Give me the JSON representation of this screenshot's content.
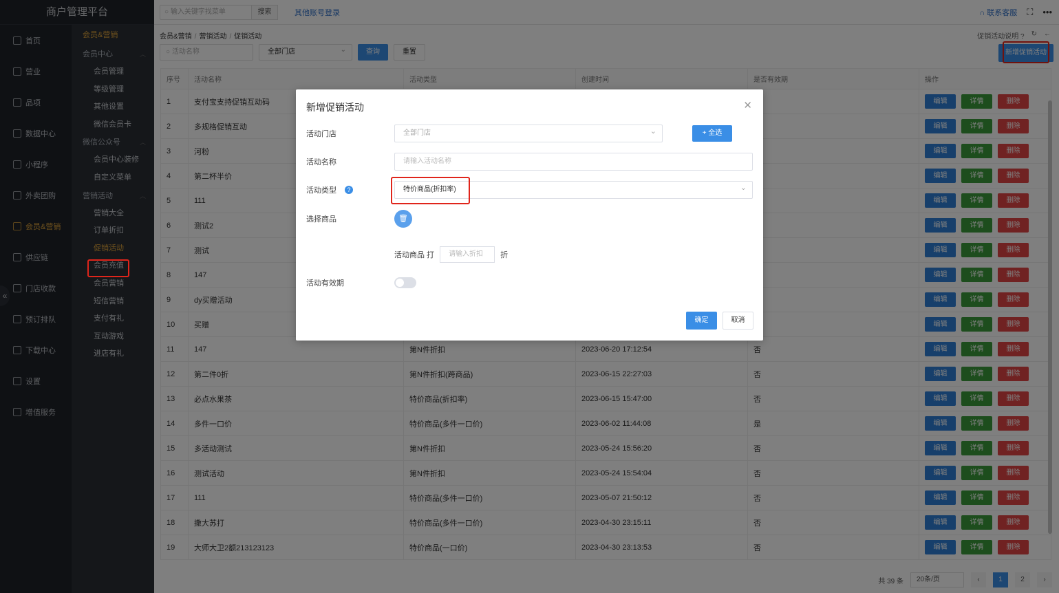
{
  "app": {
    "title": "商户管理平台"
  },
  "topbar": {
    "search_placeholder": "输入关键字找菜单",
    "search_btn": "搜索",
    "other_login": "其他账号登录",
    "contact": "联系客服"
  },
  "main_nav": [
    {
      "label": "首页",
      "icon": "home-icon"
    },
    {
      "label": "营业",
      "icon": "calendar-icon"
    },
    {
      "label": "品项",
      "icon": "bag-icon"
    },
    {
      "label": "数据中心",
      "icon": "share-icon"
    },
    {
      "label": "小程序",
      "icon": "phone-icon"
    },
    {
      "label": "外卖团购",
      "icon": "group-icon"
    },
    {
      "label": "会员&营销",
      "icon": "user-icon"
    },
    {
      "label": "供应链",
      "icon": "truck-icon"
    },
    {
      "label": "门店收款",
      "icon": "database-icon"
    },
    {
      "label": "预订排队",
      "icon": "clock-icon"
    },
    {
      "label": "下载中心",
      "icon": "download-icon"
    },
    {
      "label": "设置",
      "icon": "gear-icon"
    },
    {
      "label": "增值服务",
      "icon": "alarm-icon"
    }
  ],
  "sub_nav": {
    "header": "会员&营销",
    "groups": [
      {
        "label": "会员中心",
        "items": [
          "会员管理",
          "等级管理",
          "其他设置",
          "微信会员卡"
        ]
      },
      {
        "label": "微信公众号",
        "items": [
          "会员中心装修",
          "自定义菜单"
        ]
      },
      {
        "label": "营销活动",
        "items": [
          "营销大全",
          "订单折扣",
          "促销活动",
          "会员充值",
          "会员营销",
          "短信营销",
          "支付有礼",
          "互动游戏",
          "进店有礼"
        ]
      }
    ]
  },
  "breadcrumb": [
    "会员&营销",
    "营销活动",
    "促销活动"
  ],
  "page_help": "促销活动说明",
  "filters": {
    "name_placeholder": "活动名称",
    "store_value": "全部门店",
    "query_btn": "查询",
    "reset_btn": "重置"
  },
  "add_btn": "新增促销活动",
  "table": {
    "headers": [
      "序号",
      "活动名称",
      "活动类型",
      "创建时间",
      "是否有效期",
      "操作"
    ],
    "op_labels": {
      "edit": "编辑",
      "detail": "详情",
      "delete": "删除"
    },
    "rows": [
      {
        "no": "1",
        "name": "支付宝支持促销互动码",
        "type": "",
        "created": "",
        "valid": ""
      },
      {
        "no": "2",
        "name": "多规格促销互动",
        "type": "",
        "created": "",
        "valid": ""
      },
      {
        "no": "3",
        "name": "河粉",
        "type": "",
        "created": "",
        "valid": ""
      },
      {
        "no": "4",
        "name": "第二杯半价",
        "type": "",
        "created": "",
        "valid": ""
      },
      {
        "no": "5",
        "name": "111",
        "type": "",
        "created": "",
        "valid": ""
      },
      {
        "no": "6",
        "name": "测试2",
        "type": "",
        "created": "",
        "valid": ""
      },
      {
        "no": "7",
        "name": "测试",
        "type": "",
        "created": "",
        "valid": ""
      },
      {
        "no": "8",
        "name": "147",
        "type": "",
        "created": "",
        "valid": ""
      },
      {
        "no": "9",
        "name": "dy买赠活动",
        "type": "",
        "created": "",
        "valid": ""
      },
      {
        "no": "10",
        "name": "买赠",
        "type": "",
        "created": "",
        "valid": ""
      },
      {
        "no": "11",
        "name": "147",
        "type": "第N件折扣",
        "created": "2023-06-20 17:12:54",
        "valid": "否"
      },
      {
        "no": "12",
        "name": "第二件0折",
        "type": "第N件折扣(跨商品)",
        "created": "2023-06-15 22:27:03",
        "valid": "否"
      },
      {
        "no": "13",
        "name": "必点水果茶",
        "type": "特价商品(折扣率)",
        "created": "2023-06-15 15:47:00",
        "valid": "否"
      },
      {
        "no": "14",
        "name": "多件一口价",
        "type": "特价商品(多件一口价)",
        "created": "2023-06-02 11:44:08",
        "valid": "是"
      },
      {
        "no": "15",
        "name": "多活动测试",
        "type": "第N件折扣",
        "created": "2023-05-24 15:56:20",
        "valid": "否"
      },
      {
        "no": "16",
        "name": "测试活动",
        "type": "第N件折扣",
        "created": "2023-05-24 15:54:04",
        "valid": "否"
      },
      {
        "no": "17",
        "name": "111",
        "type": "特价商品(多件一口价)",
        "created": "2023-05-07 21:50:12",
        "valid": "否"
      },
      {
        "no": "18",
        "name": "撒大苏打",
        "type": "特价商品(多件一口价)",
        "created": "2023-04-30 23:15:11",
        "valid": "否"
      },
      {
        "no": "19",
        "name": "大师大卫2额213123123",
        "type": "特价商品(一口价)",
        "created": "2023-04-30 23:13:53",
        "valid": "否"
      }
    ]
  },
  "pager": {
    "total": "共 39 条",
    "page_size": "20条/页",
    "pages": [
      "1",
      "2"
    ]
  },
  "modal": {
    "title": "新增促销活动",
    "store_label": "活动门店",
    "store_placeholder": "全部门店",
    "select_all": "+ 全选",
    "name_label": "活动名称",
    "name_placeholder": "请输入活动名称",
    "type_label": "活动类型",
    "type_value": "特价商品(折扣率)",
    "goods_label": "选择商品",
    "discount_prefix": "活动商品 打",
    "discount_placeholder": "请输入折扣",
    "discount_suffix": "折",
    "valid_label": "活动有效期",
    "ok": "确定",
    "cancel": "取消"
  }
}
